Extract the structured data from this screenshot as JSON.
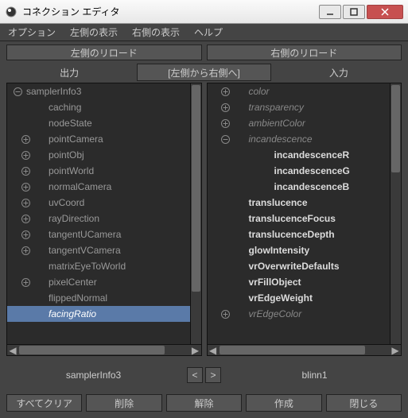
{
  "titlebar": {
    "text": "コネクション エディタ"
  },
  "menubar": {
    "options": "オプション",
    "leftDisplay": "左側の表示",
    "rightDisplay": "右側の表示",
    "help": "ヘルプ"
  },
  "reload": {
    "left": "左側のリロード",
    "right": "右側のリロード"
  },
  "headers": {
    "output": "出力",
    "direction": "[左側から右側へ]",
    "input": "入力"
  },
  "leftTree": {
    "root": "samplerInfo3",
    "items": [
      {
        "label": "caching",
        "toggle": "none"
      },
      {
        "label": "nodeState",
        "toggle": "none"
      },
      {
        "label": "pointCamera",
        "toggle": "plus"
      },
      {
        "label": "pointObj",
        "toggle": "plus"
      },
      {
        "label": "pointWorld",
        "toggle": "plus"
      },
      {
        "label": "normalCamera",
        "toggle": "plus"
      },
      {
        "label": "uvCoord",
        "toggle": "plus"
      },
      {
        "label": "rayDirection",
        "toggle": "plus"
      },
      {
        "label": "tangentUCamera",
        "toggle": "plus"
      },
      {
        "label": "tangentVCamera",
        "toggle": "plus"
      },
      {
        "label": "matrixEyeToWorld",
        "toggle": "none"
      },
      {
        "label": "pixelCenter",
        "toggle": "plus"
      },
      {
        "label": "flippedNormal",
        "toggle": "none"
      },
      {
        "label": "facingRatio",
        "toggle": "none",
        "selected": true
      }
    ]
  },
  "rightTree": {
    "items": [
      {
        "label": "color",
        "toggle": "plus",
        "dim": true,
        "level": 1
      },
      {
        "label": "transparency",
        "toggle": "plus",
        "dim": true,
        "level": 1
      },
      {
        "label": "ambientColor",
        "toggle": "plus",
        "dim": true,
        "level": 1
      },
      {
        "label": "incandescence",
        "toggle": "minus",
        "dim": true,
        "level": 1
      },
      {
        "label": "incandescenceR",
        "toggle": "none",
        "bold": true,
        "level": 2
      },
      {
        "label": "incandescenceG",
        "toggle": "none",
        "bold": true,
        "level": 2
      },
      {
        "label": "incandescenceB",
        "toggle": "none",
        "bold": true,
        "level": 2
      },
      {
        "label": "translucence",
        "toggle": "none",
        "bold": true,
        "level": 1
      },
      {
        "label": "translucenceFocus",
        "toggle": "none",
        "bold": true,
        "level": 1
      },
      {
        "label": "translucenceDepth",
        "toggle": "none",
        "bold": true,
        "level": 1
      },
      {
        "label": "glowIntensity",
        "toggle": "none",
        "bold": true,
        "level": 1
      },
      {
        "label": "vrOverwriteDefaults",
        "toggle": "none",
        "bold": true,
        "level": 1
      },
      {
        "label": "vrFillObject",
        "toggle": "none",
        "bold": true,
        "level": 1
      },
      {
        "label": "vrEdgeWeight",
        "toggle": "none",
        "bold": true,
        "level": 1
      },
      {
        "label": "vrEdgeColor",
        "toggle": "plus",
        "dim": true,
        "level": 1
      }
    ]
  },
  "names": {
    "left": "samplerInfo3",
    "right": "blinn1",
    "prev": "<",
    "next": ">"
  },
  "bottom": {
    "clearAll": "すべてクリア",
    "delete": "削除",
    "break": "解除",
    "make": "作成",
    "close": "閉じる"
  }
}
